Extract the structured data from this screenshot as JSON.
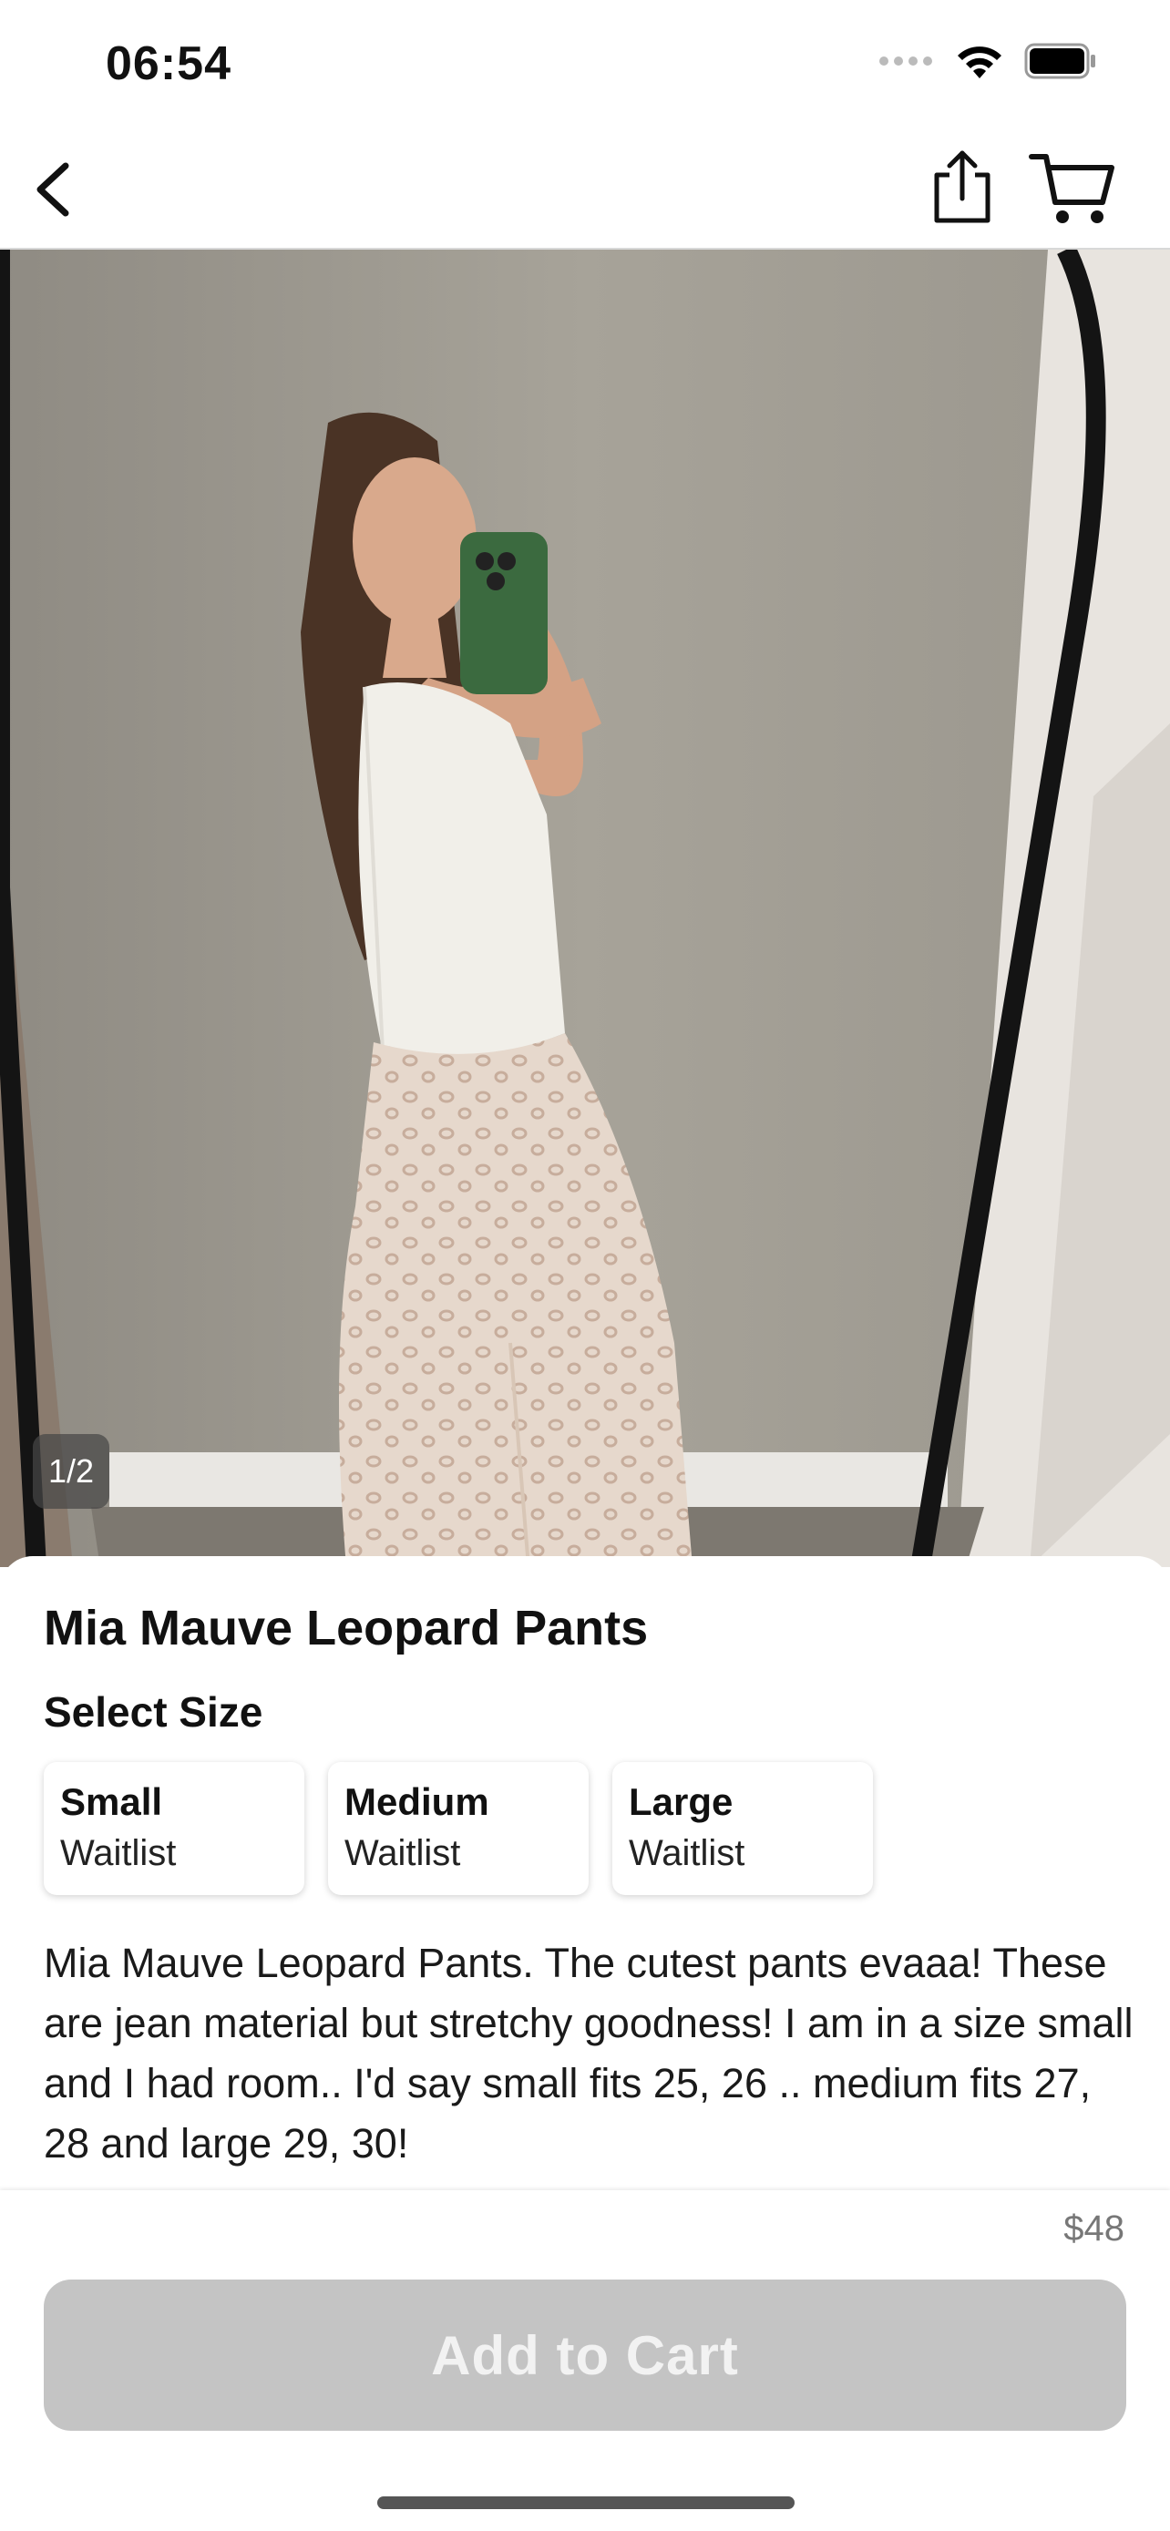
{
  "status_bar": {
    "time": "06:54",
    "icons": [
      "signal-dots-icon",
      "wifi-icon",
      "battery-icon"
    ]
  },
  "nav": {
    "back_icon": "chevron-left-icon",
    "share_icon": "share-icon",
    "cart_icon": "cart-icon"
  },
  "gallery": {
    "counter": "1/2"
  },
  "product": {
    "title": "Mia Mauve Leopard Pants",
    "select_size_label": "Select Size",
    "sizes": [
      {
        "name": "Small",
        "status": "Waitlist"
      },
      {
        "name": "Medium",
        "status": "Waitlist"
      },
      {
        "name": "Large",
        "status": "Waitlist"
      }
    ],
    "description": "Mia Mauve Leopard Pants. The cutest pants evaaa! These are jean material but stretchy goodness! I am in a size small and I had room.. I'd say small fits 25, 26 .. medium fits 27, 28 and large 29, 30!",
    "price": "$48"
  },
  "footer": {
    "add_to_cart_label": "Add to Cart"
  },
  "colors": {
    "button_disabled": "#c4c4c4",
    "text_primary": "#111111",
    "price_gray": "#777777"
  }
}
